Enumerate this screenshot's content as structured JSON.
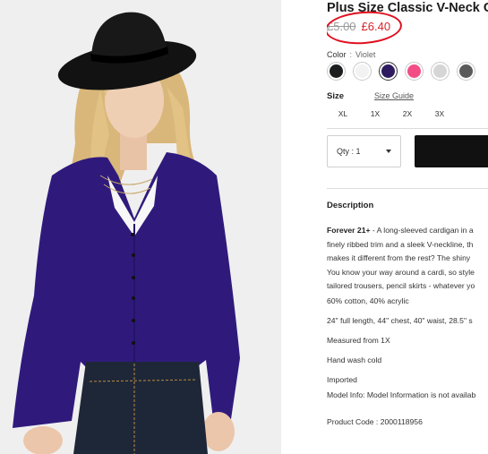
{
  "product": {
    "title": "Plus Size Classic V-Neck C",
    "old_price": "£5.00",
    "new_price": "£6.40"
  },
  "color": {
    "label": "Color",
    "separator": ":",
    "selected": "Violet",
    "swatches": [
      {
        "name": "black",
        "hex": "#1b1d1f"
      },
      {
        "name": "white",
        "hex": "#f2f2f2"
      },
      {
        "name": "violet",
        "hex": "#2e1a5e"
      },
      {
        "name": "pink",
        "hex": "#f24d86"
      },
      {
        "name": "light-grey",
        "hex": "#d6d6d6"
      },
      {
        "name": "charcoal-marl",
        "hex": "#5a5a5a"
      }
    ]
  },
  "size": {
    "label": "Size",
    "guide_link": "Size Guide",
    "options": [
      "XL",
      "1X",
      "2X",
      "3X"
    ]
  },
  "quantity": {
    "label": "Qty : 1"
  },
  "description": {
    "title": "Description",
    "brand": "Forever 21+",
    "body_lines": [
      " - A long-sleeved cardigan in a",
      "finely ribbed trim and a sleek V-neckline, th",
      "makes it different from the rest? The shiny",
      "You know your way around a cardi, so style",
      "tailored trousers, pencil skirts - whatever yo"
    ],
    "composition": "60% cotton, 40% acrylic",
    "measurements": "24\" full length, 44\" chest, 40\" waist, 28.5\" s",
    "measured_from": "Measured from 1X",
    "care": "Hand wash cold",
    "origin": "Imported",
    "model_info": "Model Info: Model Information is not availab",
    "product_code": "Product Code : 2000118956"
  }
}
